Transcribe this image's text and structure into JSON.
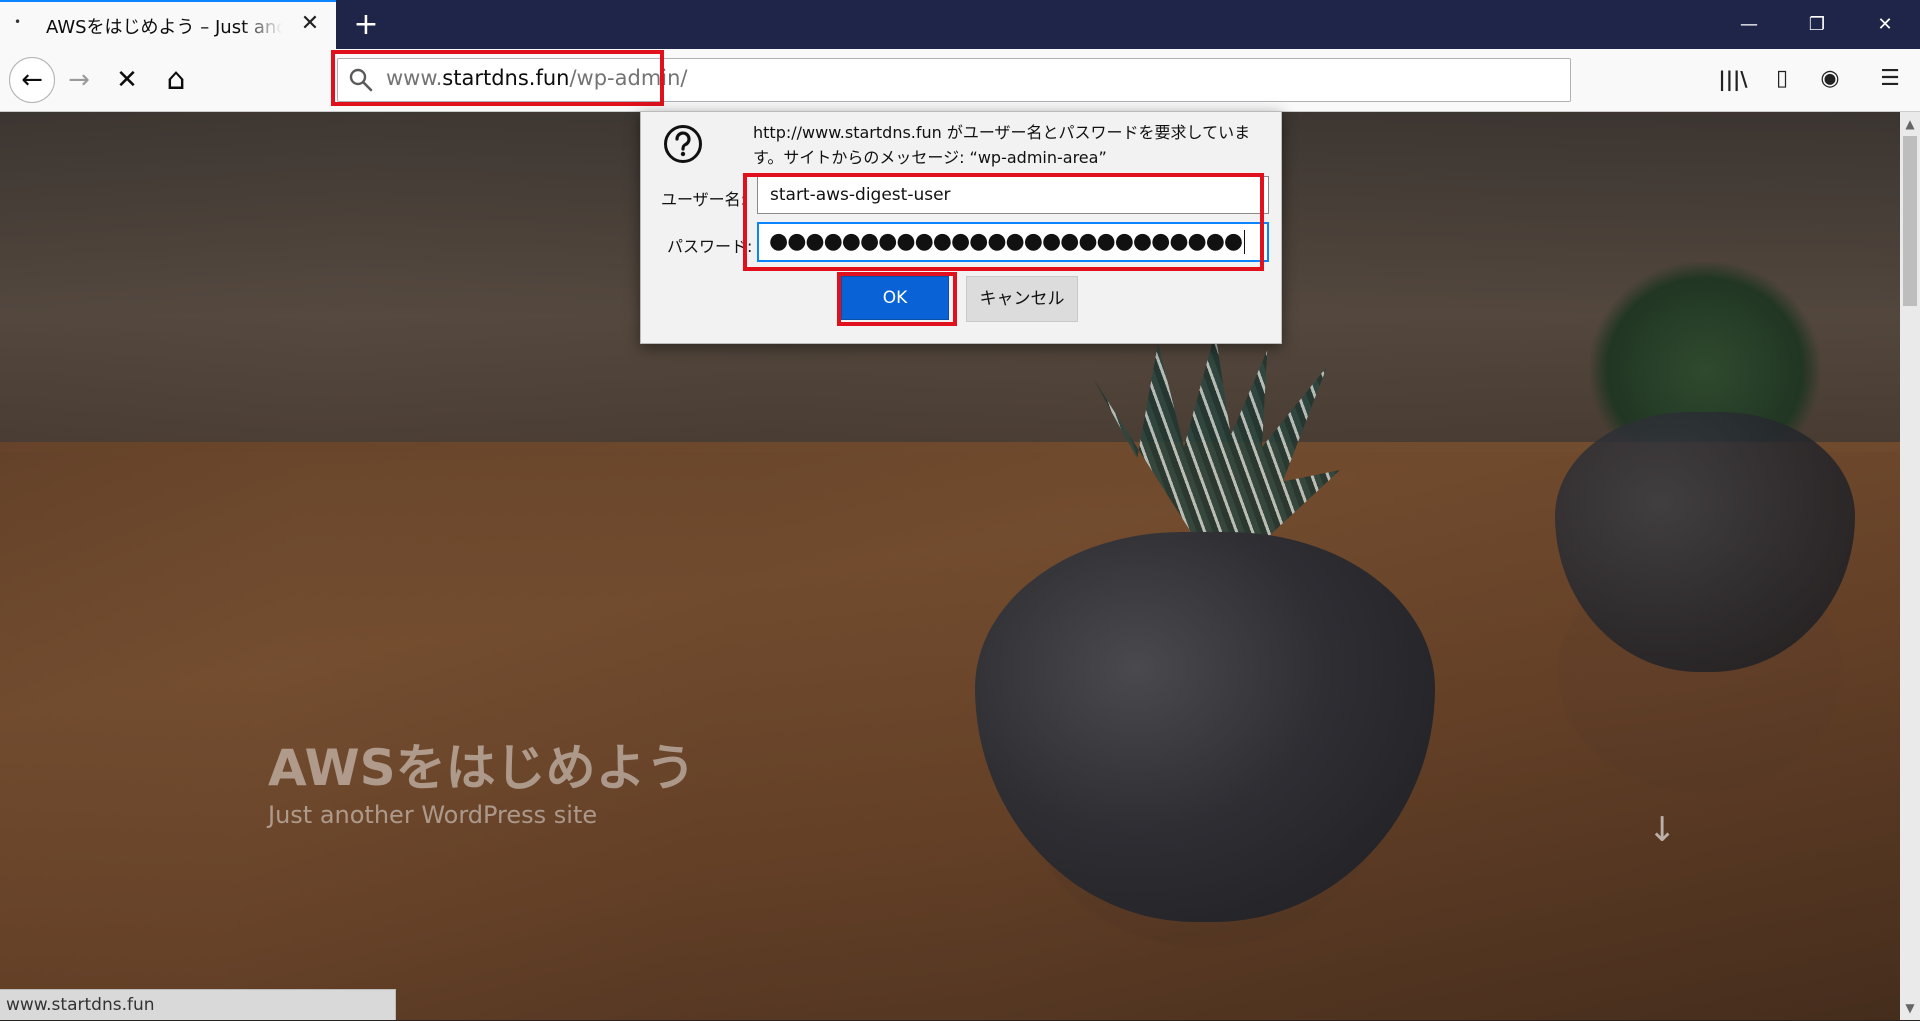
{
  "browser": {
    "tab": {
      "title": "AWSをはじめよう – Just another WordPress site",
      "dot": "•",
      "close_glyph": "✕"
    },
    "newtab_glyph": "+",
    "window_controls": {
      "minimize": "—",
      "restore": "❐",
      "close": "✕"
    },
    "nav": {
      "back_glyph": "←",
      "forward_glyph": "→",
      "stop_glyph": "✕",
      "home_glyph": "⌂"
    },
    "url": {
      "prefix": "www.",
      "domain": "startdns.fun",
      "path": "/wp-admin/"
    },
    "toolbar": {
      "library_glyph": "|||\\",
      "sidebar_glyph": "▯",
      "account_glyph": "◉",
      "menu_glyph": "☰"
    }
  },
  "page": {
    "site_title": "AWSをはじめよう",
    "site_tagline": "Just another WordPress site",
    "scroll_glyph": "↓"
  },
  "status_bar": {
    "text": "www.startdns.fun"
  },
  "auth_dialog": {
    "message": "http://www.startdns.fun がユーザー名とパスワードを要求しています。サイトからのメッセージ: “wp-admin-area”",
    "username_label": "ユーザー名:",
    "username_value": "start-aws-digest-user",
    "password_label": "パスワード:",
    "password_masked": "●●●●●●●●●●●●●●●●●●●●●●●●●●",
    "ok_label": "OK",
    "cancel_label": "キャンセル"
  },
  "colors": {
    "highlight": "#e0101d",
    "accent": "#0a84ff",
    "ok_button": "#0a63d6",
    "tab_bar": "#1f2548"
  }
}
